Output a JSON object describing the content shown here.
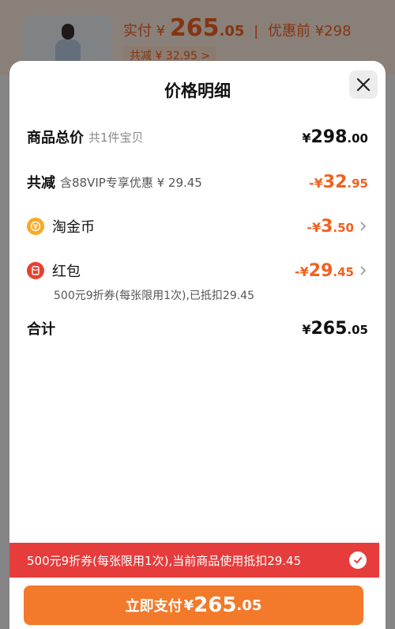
{
  "background": {
    "price_prefix": "实付",
    "currency": "¥",
    "price_int": "265",
    "price_dec": ".05",
    "before_label": "优惠前",
    "before_price": "¥298",
    "discount_tag": "共减 ¥ 32.95 >"
  },
  "sheet": {
    "title": "价格明细",
    "rows": {
      "total": {
        "label": "商品总价",
        "sub": "共1件宝贝",
        "yen": "¥",
        "int": "298",
        "dec": ".00"
      },
      "reduce": {
        "label": "共减",
        "sub": "含88VIP专享优惠 ¥ 29.45",
        "yen": "-¥",
        "int": "32",
        "dec": ".95"
      },
      "coins": {
        "label": "淘金币",
        "yen": "-¥",
        "int": "3",
        "dec": ".50"
      },
      "redpacket": {
        "label": "红包",
        "yen": "-¥",
        "int": "29",
        "dec": ".45",
        "note": "500元9折券(每张限用1次),已抵扣29.45"
      },
      "sum": {
        "label": "合计",
        "yen": "¥",
        "int": "265",
        "dec": ".05"
      }
    }
  },
  "banner": {
    "text": "500元9折券(每张限用1次),当前商品使用抵扣29.45"
  },
  "pay_button": {
    "label": "立即支付",
    "yen": "¥",
    "int": "265",
    "dec": ".05"
  },
  "colors": {
    "accent": "#f2601f",
    "banner": "#e63c3c",
    "button": "#f27a2a"
  }
}
